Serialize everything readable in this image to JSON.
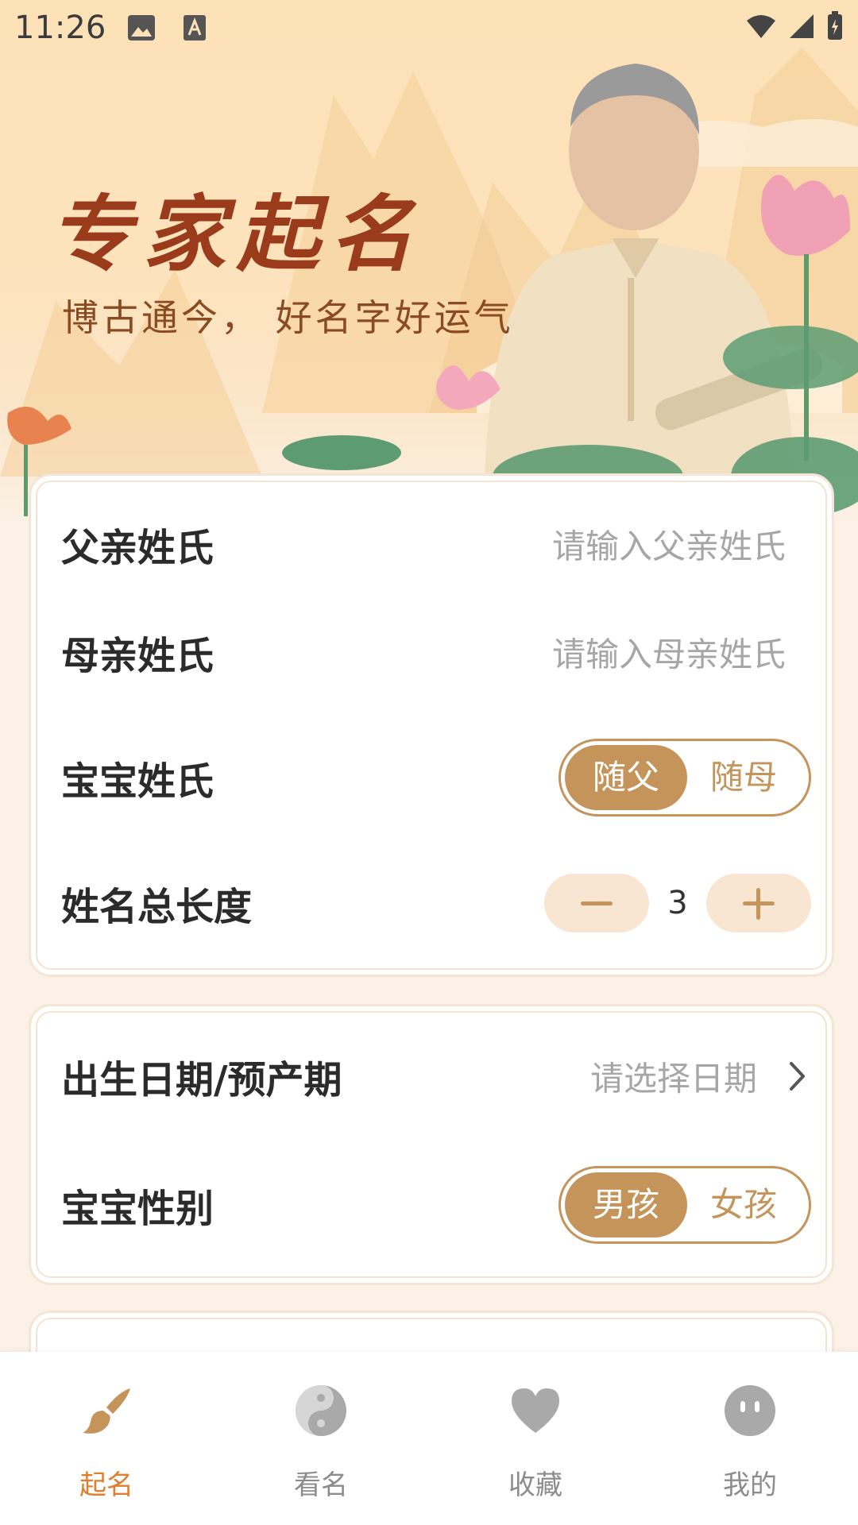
{
  "status_bar": {
    "time": "11:26"
  },
  "hero": {
    "title": "专家起名",
    "subtitle": "博古通今， 好名字好运气"
  },
  "form": {
    "father_surname": {
      "label": "父亲姓氏",
      "placeholder": "请输入父亲姓氏"
    },
    "mother_surname": {
      "label": "母亲姓氏",
      "placeholder": "请输入母亲姓氏"
    },
    "baby_surname": {
      "label": "宝宝姓氏",
      "options": [
        "随父",
        "随母"
      ],
      "selected": "随父"
    },
    "name_length": {
      "label": "姓名总长度",
      "value": "3"
    },
    "birth_date": {
      "label": "出生日期/预产期",
      "placeholder": "请选择日期"
    },
    "baby_gender": {
      "label": "宝宝性别",
      "options": [
        "男孩",
        "女孩"
      ],
      "selected": "男孩"
    }
  },
  "bottom_nav": {
    "items": [
      {
        "label": "起名",
        "icon": "brush-icon",
        "active": true
      },
      {
        "label": "看名",
        "icon": "yin-yang-icon",
        "active": false
      },
      {
        "label": "收藏",
        "icon": "heart-icon",
        "active": false
      },
      {
        "label": "我的",
        "icon": "face-icon",
        "active": false
      }
    ]
  },
  "colors": {
    "accent": "#c4945a",
    "nav_active": "#e07f2a",
    "title": "#9a3b1b",
    "background": "#fbf1e6"
  }
}
